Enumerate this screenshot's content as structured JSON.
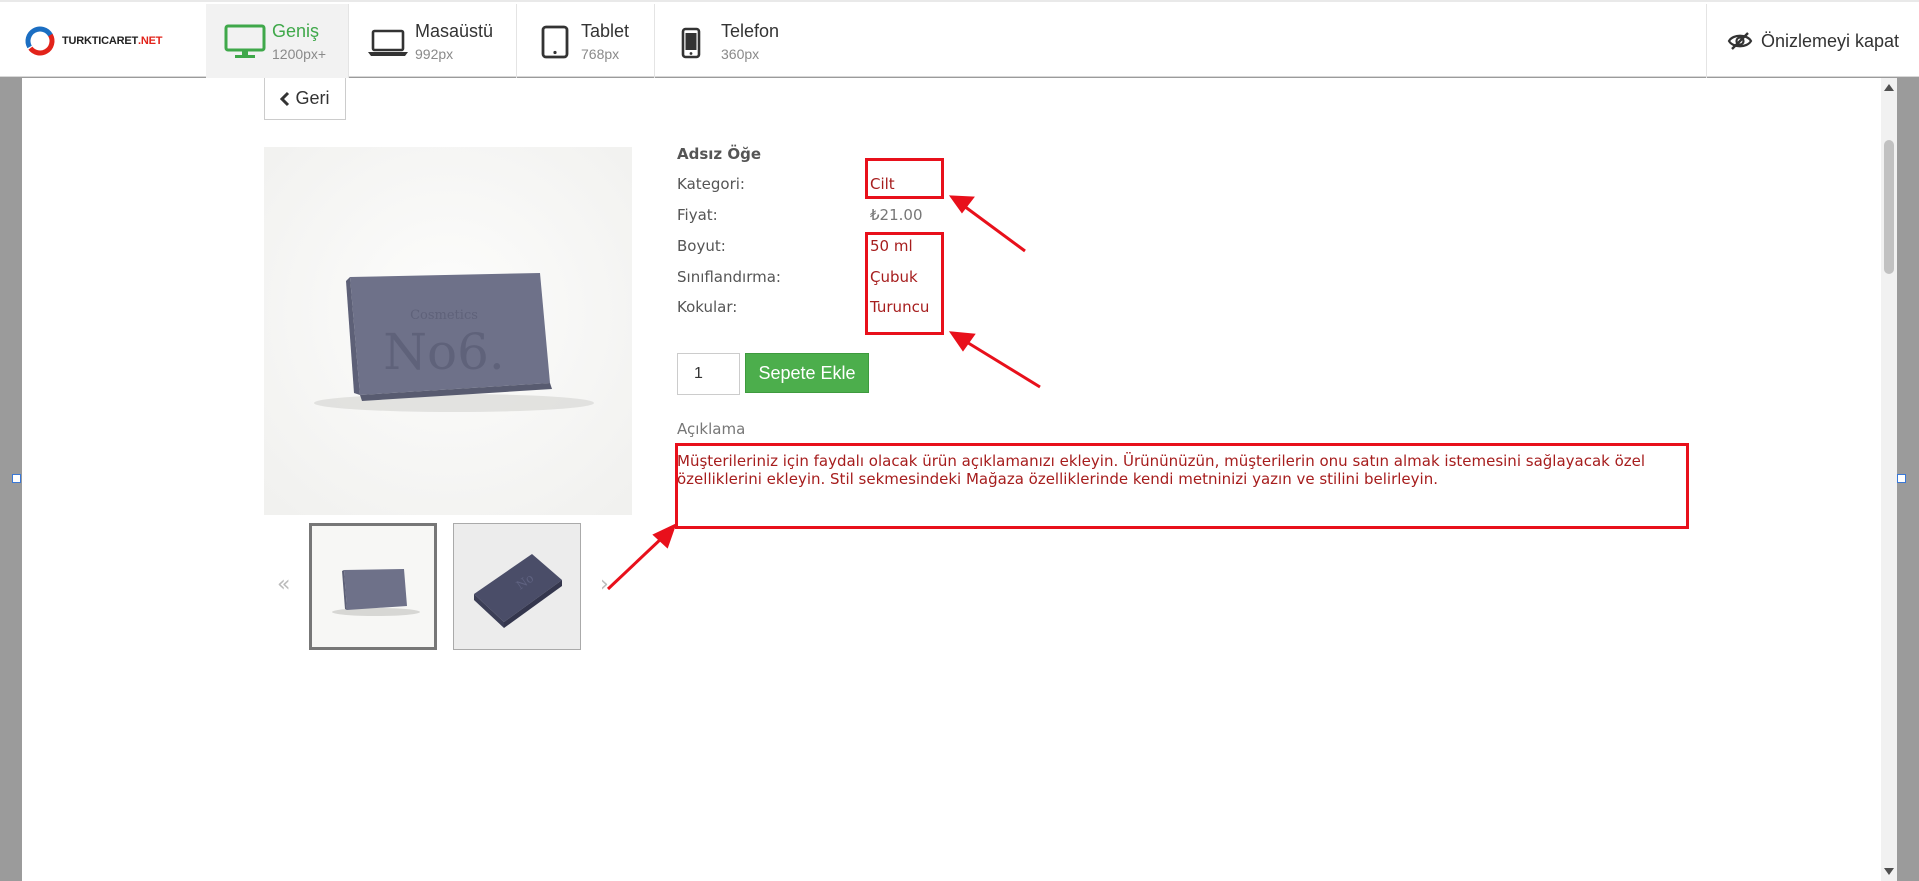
{
  "topbar": {
    "logo_text_main": "TURKTICARET",
    "logo_text_suffix": ".NET",
    "devices": [
      {
        "name": "Geniş",
        "size": "1200px+",
        "icon": "monitor-icon",
        "active": true
      },
      {
        "name": "Masaüstü",
        "size": "992px",
        "icon": "laptop-icon",
        "active": false
      },
      {
        "name": "Tablet",
        "size": "768px",
        "icon": "tablet-icon",
        "active": false
      },
      {
        "name": "Telefon",
        "size": "360px",
        "icon": "phone-icon",
        "active": false
      }
    ],
    "close_preview_label": "Önizlemeyi kapat",
    "close_preview_icon": "eye-slash-icon"
  },
  "product": {
    "back_label": "Geri",
    "title": "Adsız Öğe",
    "attributes": [
      {
        "label": "Kategori:",
        "value": "Cilt"
      },
      {
        "label": "Fiyat:",
        "value": "₺21.00"
      },
      {
        "label": "Boyut:",
        "value": "50 ml"
      },
      {
        "label": "Sınıflandırma:",
        "value": "Çubuk"
      },
      {
        "label": "Kokular:",
        "value": "Turuncu"
      }
    ],
    "quantity": "1",
    "add_to_cart_label": "Sepete Ekle",
    "description_heading": "Açıklama",
    "description_text": "Müşterileriniz için faydalı olacak ürün açıklamanızı ekleyin. Ürününüzün, müşterilerin onu satın almak istemesini sağlayacak özel özelliklerini ekleyin. Stil sekmesindeki Mağaza özelliklerinde kendi metninizi yazın ve stilini belirleyin.",
    "soap_engraving_small": "Cosmetics",
    "soap_engraving_big": "No6.",
    "thumbnails_prev_icon": "chevron-double-left-icon",
    "thumbnails_next_icon": "chevron-right-icon"
  },
  "colors": {
    "accent_green": "#4cae4c",
    "annotation_red": "#e8101b",
    "value_red": "#a61d1d"
  }
}
